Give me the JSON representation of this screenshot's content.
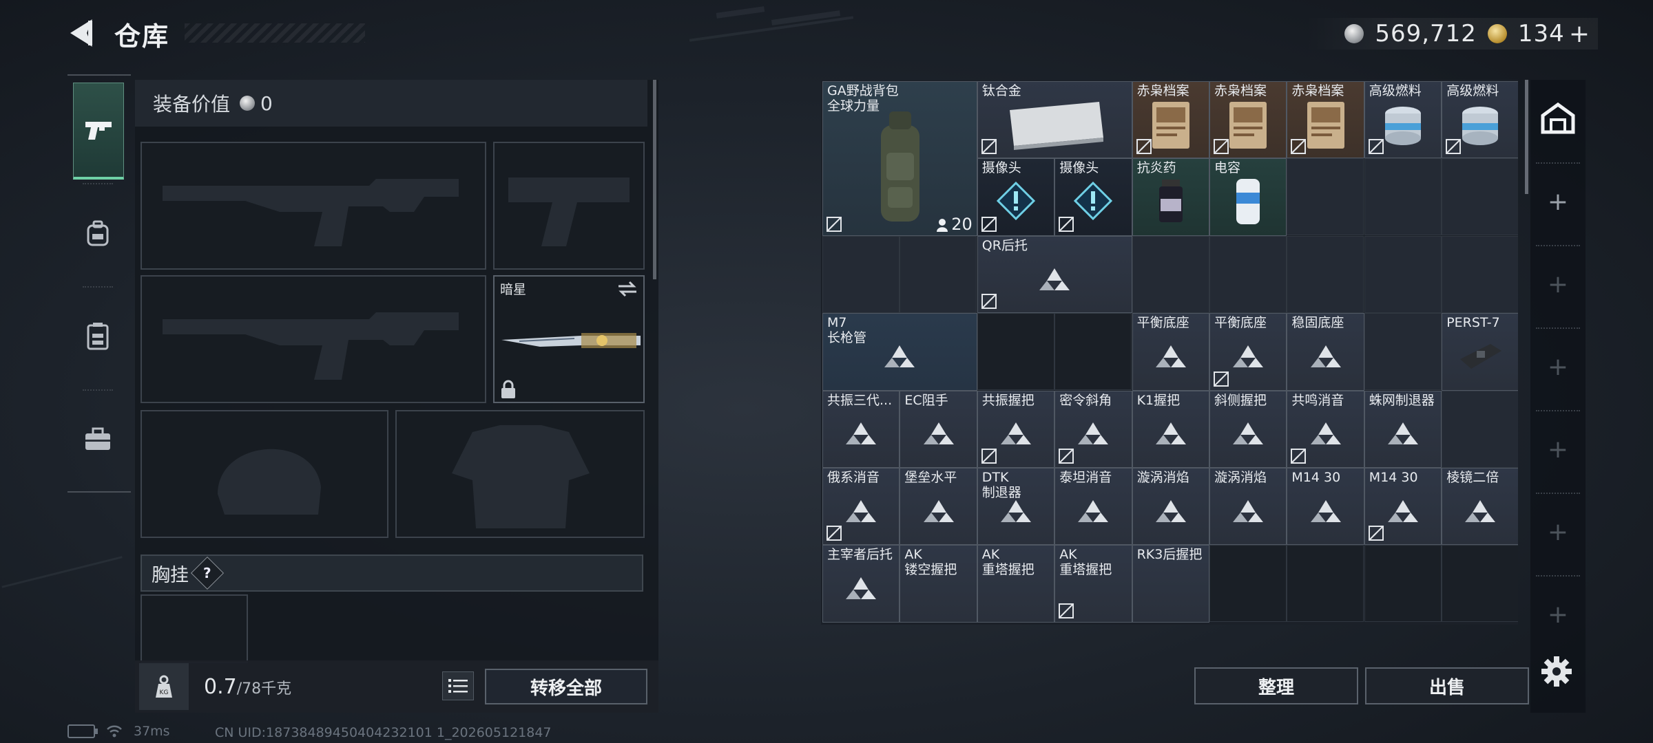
{
  "header": {
    "title": "仓库"
  },
  "currency": {
    "silver": "569,712",
    "gold": "134",
    "gold_plus": "+"
  },
  "top_tiny": "",
  "equip": {
    "value_label": "装备价值",
    "value": "0",
    "knife_name": "暗星",
    "chest_label": "胸挂",
    "chest_help": "?"
  },
  "footer": {
    "weight_current": "0.7",
    "weight_max": "/78千克",
    "transfer_label": "转移全部"
  },
  "grid": {
    "items": [
      {
        "name": "GA野战背包",
        "name2": "全球力量",
        "count": "20"
      },
      {
        "name": "钛合金"
      },
      {
        "name": "赤枭档案"
      },
      {
        "name": "赤枭档案"
      },
      {
        "name": "赤枭档案"
      },
      {
        "name": "高级燃料"
      },
      {
        "name": "高级燃料"
      },
      {
        "name": "摄像头"
      },
      {
        "name": "摄像头"
      },
      {
        "name": "抗炎药"
      },
      {
        "name": "电容"
      },
      {
        "name": "QR后托"
      },
      {
        "name": "M7",
        "name2": "长枪管"
      },
      {
        "name": "平衡底座"
      },
      {
        "name": "平衡底座"
      },
      {
        "name": "稳固底座"
      },
      {
        "name": "PERST-7"
      },
      {
        "name": "共振三代..."
      },
      {
        "name": "EC阻手"
      },
      {
        "name": "共振握把"
      },
      {
        "name": "密令斜角"
      },
      {
        "name": "K1握把"
      },
      {
        "name": "斜侧握把"
      },
      {
        "name": "共鸣消音"
      },
      {
        "name": "蛛网制退器"
      },
      {
        "name": "俄系消音"
      },
      {
        "name": "堡垒水平"
      },
      {
        "name": "DTK",
        "name2": "制退器"
      },
      {
        "name": "泰坦消音"
      },
      {
        "name": "漩涡消焰"
      },
      {
        "name": "漩涡消焰"
      },
      {
        "name": "M14 30"
      },
      {
        "name": "M14 30"
      },
      {
        "name": "棱镜二倍"
      },
      {
        "name": "主宰者后托"
      },
      {
        "name": "AK",
        "name2": "镂空握把"
      },
      {
        "name": "AK",
        "name2": "重塔握把"
      },
      {
        "name": "AK",
        "name2": "重塔握把"
      },
      {
        "name": "RK3后握把"
      }
    ]
  },
  "buttons": {
    "sort": "整理",
    "sell": "出售"
  },
  "status": {
    "ping": "37ms",
    "uid": "CN UID:18738489450404232101 1_202605121847"
  },
  "colors": {
    "accent_green": "#6fd0a6",
    "bg": "#1c222a"
  }
}
